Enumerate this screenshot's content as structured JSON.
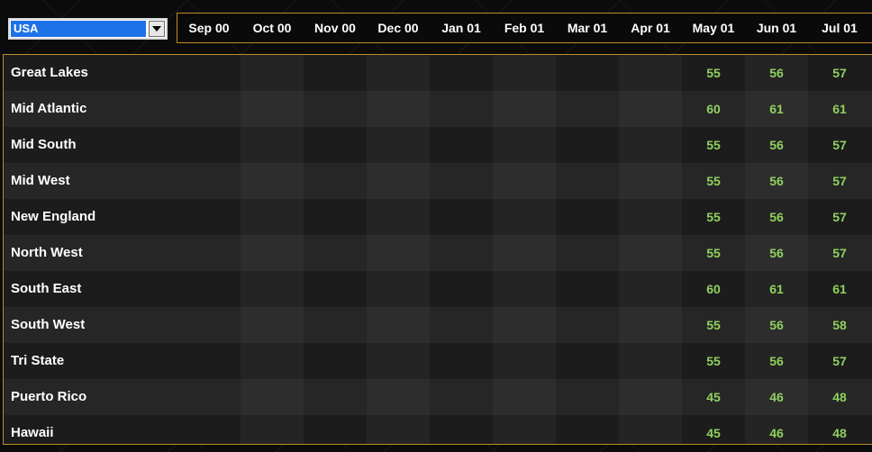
{
  "region_select": {
    "value": "USA"
  },
  "months": [
    "Sep 00",
    "Oct 00",
    "Nov 00",
    "Dec 00",
    "Jan 01",
    "Feb 01",
    "Mar 01",
    "Apr 01",
    "May 01",
    "Jun 01",
    "Jul 01"
  ],
  "rows": [
    {
      "region": "Great Lakes",
      "values": [
        "",
        "",
        "",
        "",
        "",
        "",
        "",
        "",
        "55",
        "56",
        "57"
      ]
    },
    {
      "region": "Mid Atlantic",
      "values": [
        "",
        "",
        "",
        "",
        "",
        "",
        "",
        "",
        "60",
        "61",
        "61"
      ]
    },
    {
      "region": "Mid South",
      "values": [
        "",
        "",
        "",
        "",
        "",
        "",
        "",
        "",
        "55",
        "56",
        "57"
      ]
    },
    {
      "region": "Mid West",
      "values": [
        "",
        "",
        "",
        "",
        "",
        "",
        "",
        "",
        "55",
        "56",
        "57"
      ]
    },
    {
      "region": "New England",
      "values": [
        "",
        "",
        "",
        "",
        "",
        "",
        "",
        "",
        "55",
        "56",
        "57"
      ]
    },
    {
      "region": "North West",
      "values": [
        "",
        "",
        "",
        "",
        "",
        "",
        "",
        "",
        "55",
        "56",
        "57"
      ]
    },
    {
      "region": "South East",
      "values": [
        "",
        "",
        "",
        "",
        "",
        "",
        "",
        "",
        "60",
        "61",
        "61"
      ]
    },
    {
      "region": "South West",
      "values": [
        "",
        "",
        "",
        "",
        "",
        "",
        "",
        "",
        "55",
        "56",
        "58"
      ]
    },
    {
      "region": "Tri State",
      "values": [
        "",
        "",
        "",
        "",
        "",
        "",
        "",
        "",
        "55",
        "56",
        "57"
      ]
    },
    {
      "region": "Puerto Rico",
      "values": [
        "",
        "",
        "",
        "",
        "",
        "",
        "",
        "",
        "45",
        "46",
        "48"
      ]
    },
    {
      "region": "Hawaii",
      "values": [
        "",
        "",
        "",
        "",
        "",
        "",
        "",
        "",
        "45",
        "46",
        "48"
      ]
    }
  ],
  "colors": {
    "value_text": "#8fd15f",
    "frame": "#c08a2a",
    "select_highlight": "#1e72e8"
  },
  "icons": {
    "dropdown": "chevron-down-icon"
  }
}
